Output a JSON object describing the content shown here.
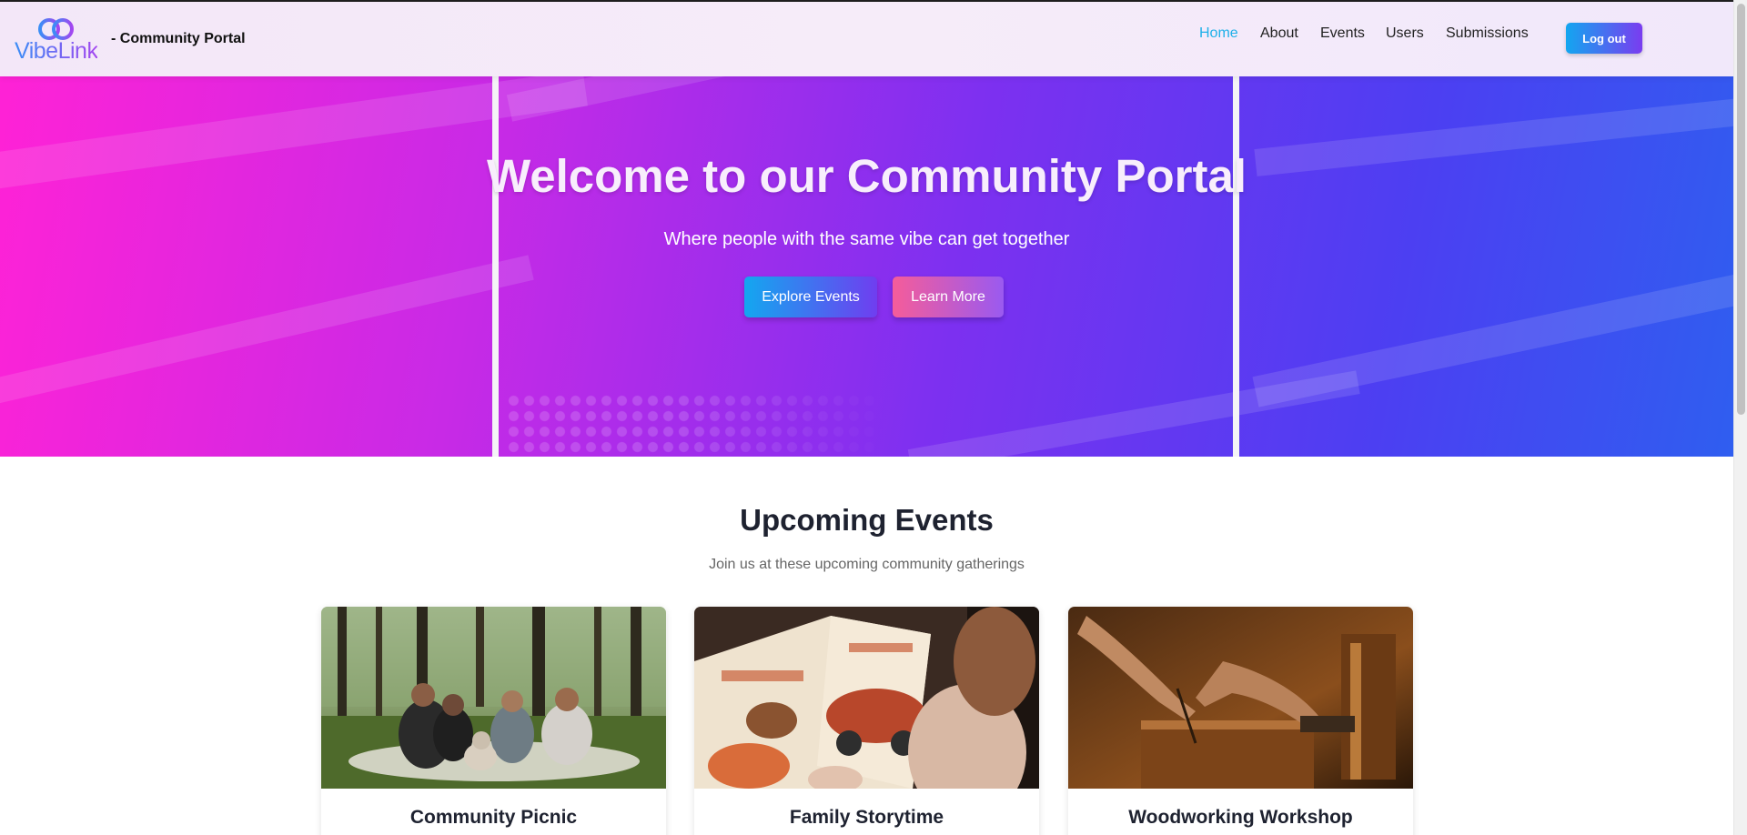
{
  "brand": {
    "logo_text": "VibeLink",
    "subtitle": "- Community Portal"
  },
  "nav": {
    "items": [
      {
        "label": "Home",
        "active": true
      },
      {
        "label": "About",
        "active": false
      },
      {
        "label": "Events",
        "active": false
      },
      {
        "label": "Users",
        "active": false
      },
      {
        "label": "Submissions",
        "active": false
      }
    ],
    "logout_label": "Log out"
  },
  "hero": {
    "title": "Welcome to our Community Portal",
    "subtitle": "Where people with the same vibe can get together",
    "primary_button": "Explore Events",
    "secondary_button": "Learn More"
  },
  "events": {
    "title": "Upcoming Events",
    "subtitle": "Join us at these upcoming community gatherings",
    "cards": [
      {
        "title": "Community Picnic"
      },
      {
        "title": "Family Storytime"
      },
      {
        "title": "Woodworking Workshop"
      }
    ]
  },
  "colors": {
    "accent": "#1fb0e9",
    "hero_start": "#ff22d6",
    "hero_end": "#2f5ef0",
    "heading": "#1e2230"
  }
}
